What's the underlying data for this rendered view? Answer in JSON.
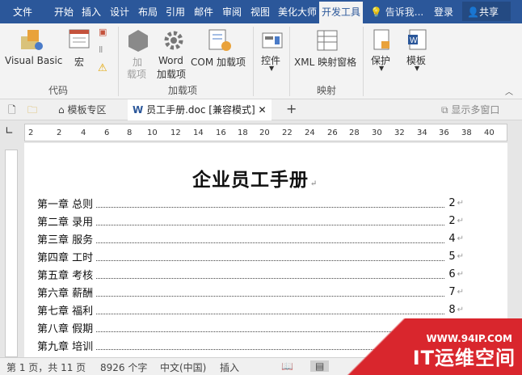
{
  "ribbon_tabs": [
    "文件",
    "开始",
    "插入",
    "设计",
    "布局",
    "引用",
    "邮件",
    "审阅",
    "视图",
    "美化大师",
    "开发工具"
  ],
  "tell_me": "告诉我...",
  "login": "登录",
  "share": "共享",
  "ribbon": {
    "visual_basic": "Visual Basic",
    "macro": "宏",
    "addin_line1": "加",
    "addin_line2": "载项",
    "word_line1": "Word",
    "word_line2": "加载项",
    "com_addin": "COM 加载项",
    "controls": "控件",
    "xml_mapping": "XML 映射窗格",
    "protect": "保护",
    "template": "模板",
    "group_code": "代码",
    "group_addins": "加载项",
    "group_mapping": "映射"
  },
  "doc_tabs": {
    "templates": "模板专区",
    "doc": "员工手册.doc [兼容模式]",
    "multi": "显示多窗口"
  },
  "ruler_ticks": [
    "2",
    "2",
    "4",
    "6",
    "8",
    "10",
    "12",
    "14",
    "16",
    "18",
    "20",
    "22",
    "24",
    "26",
    "28",
    "30",
    "32",
    "34",
    "36",
    "38",
    "40"
  ],
  "doc": {
    "title": "企业员工手册",
    "toc": [
      {
        "chapter": "第一章  总则",
        "page": "2"
      },
      {
        "chapter": "第二章  录用",
        "page": "2"
      },
      {
        "chapter": "第三章  服务",
        "page": "4"
      },
      {
        "chapter": "第四章  工时",
        "page": "5"
      },
      {
        "chapter": "第五章  考核",
        "page": "6"
      },
      {
        "chapter": "第六章  薪酬",
        "page": "7"
      },
      {
        "chapter": "第七章  福利",
        "page": "8"
      },
      {
        "chapter": "第八章  假期",
        "page": ""
      },
      {
        "chapter": "第九章  培训",
        "page": ""
      }
    ]
  },
  "status": {
    "page": "第 1 页，共 11 页",
    "words": "8926 个字",
    "lang": "中文(中国)",
    "insert": "插入"
  },
  "watermark": {
    "url": "WWW.94IP.COM",
    "text": "IT运维空间"
  },
  "colors": {
    "ribbon_blue": "#2b579a",
    "watermark_red": "#d9262d"
  }
}
